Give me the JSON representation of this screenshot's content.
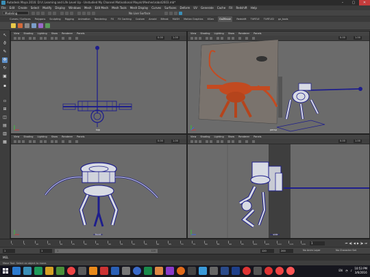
{
  "app": {
    "title": "Autodesk Maya 2016: D:\\r\\ Learning and Life Level Up - Unstudied My Channel Motivational Maya\\r\\Meshes\\robot2603.mb*"
  },
  "window": {
    "min": "–",
    "max": "▢",
    "close": "✕"
  },
  "menubar": {
    "items": [
      "File",
      "Edit",
      "Create",
      "Select",
      "Modify",
      "Display",
      "Windows",
      "Mesh",
      "Edit Mesh",
      "Mesh Tools",
      "Mesh Display",
      "Curves",
      "Surfaces",
      "Deform",
      "UV",
      "Generate",
      "Cache",
      "Fill",
      "Redshift",
      "Help"
    ]
  },
  "status": {
    "mode": "Modeling",
    "no_live_surface": "No Live Surface"
  },
  "shelf": {
    "tabs": [
      "Curves / Surfaces",
      "Polygons",
      "Sculpting",
      "Rigging",
      "Animation",
      "Rendering",
      "FX",
      "FX Caching",
      "Custom",
      "Arnold",
      "Bifrost",
      "MASH",
      "Motion Graphics",
      "XGen",
      "GoZBrush",
      "Redshift",
      "TURTLE",
      "TURTLE2",
      "gz_tools"
    ],
    "active_tab": "GoZBrush"
  },
  "viewports": [
    {
      "id": "top",
      "label": "top",
      "menu": [
        "View",
        "Shading",
        "Lighting",
        "Show",
        "Renderer",
        "Panels"
      ],
      "near": "0.00",
      "far": "1.00"
    },
    {
      "id": "persp",
      "label": "persp",
      "menu": [
        "View",
        "Shading",
        "Lighting",
        "Show",
        "Renderer",
        "Panels"
      ],
      "near": "0.00",
      "far": "1.00"
    },
    {
      "id": "front",
      "label": "front",
      "menu": [
        "View",
        "Shading",
        "Lighting",
        "Show",
        "Renderer",
        "Panels"
      ],
      "near": "0.00",
      "far": "1.00"
    },
    {
      "id": "side",
      "label": "side",
      "menu": [
        "View",
        "Shading",
        "Lighting",
        "Show",
        "Renderer",
        "Panels"
      ],
      "near": "0.00",
      "far": "1.00"
    }
  ],
  "timeline": {
    "ticks": [
      "1",
      "5",
      "10",
      "15",
      "20",
      "25",
      "30",
      "35",
      "40",
      "45",
      "50",
      "55",
      "60",
      "65",
      "70",
      "75",
      "80",
      "85",
      "90",
      "95",
      "100",
      "105",
      "110",
      "115",
      "120"
    ],
    "current_frame": "1",
    "play_buttons": [
      "⏮",
      "◀|",
      "◀",
      "▶",
      "|▶",
      "⏭"
    ]
  },
  "range": {
    "start": "1",
    "inner_start": "1",
    "slider_start": "1",
    "slider_end": "120",
    "end": "120",
    "outer_end": "200",
    "anim_layer": "No Anim Layer",
    "character_set": "No Character Set"
  },
  "command": {
    "language": "MEL"
  },
  "help": {
    "text": "Move Tool: Select an object to move."
  },
  "taskbar": {
    "tray_lang": "EN",
    "time": "10:53 PM",
    "date": "3/6/2016"
  },
  "colors": {
    "viewport_bg": "#6b6b6b",
    "wire_blue": "#1e1e8c",
    "highlight_red": "#c44a20",
    "timeline_bg": "#3b3b3b"
  }
}
